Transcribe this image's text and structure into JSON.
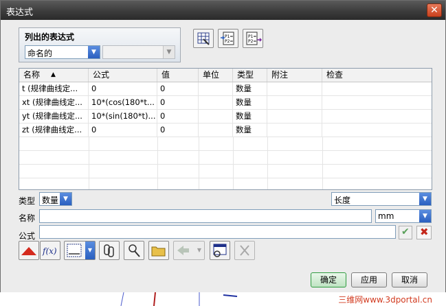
{
  "window": {
    "title": "表达式",
    "close_icon": "close-icon"
  },
  "list_group": {
    "title": "列出的表达式",
    "filter_value": "命名的",
    "secondary_value": ""
  },
  "table": {
    "columns": [
      "名称",
      "公式",
      "值",
      "单位",
      "类型",
      "附注",
      "检查"
    ],
    "rows": [
      {
        "name": "t (规律曲线定...",
        "formula": "0",
        "value": "0",
        "unit": "",
        "type": "数量",
        "note": "",
        "check": ""
      },
      {
        "name": "xt (规律曲线定...",
        "formula": "10*(cos(180*t...",
        "value": "0",
        "unit": "",
        "type": "数量",
        "note": "",
        "check": ""
      },
      {
        "name": "yt (规律曲线定...",
        "formula": "10*(sin(180*t)...",
        "value": "0",
        "unit": "",
        "type": "数量",
        "note": "",
        "check": ""
      },
      {
        "name": "zt (规律曲线定...",
        "formula": "0",
        "value": "0",
        "unit": "",
        "type": "数量",
        "note": "",
        "check": ""
      }
    ]
  },
  "form": {
    "type_label": "类型",
    "type_value": "数量",
    "dimension_value": "长度",
    "name_label": "名称",
    "name_value": "",
    "unit_value": "mm",
    "formula_label": "公式",
    "formula_value": ""
  },
  "footer": {
    "ok_label": "确定",
    "apply_label": "应用",
    "cancel_label": "取消"
  },
  "watermark": "三维网www.3dportal.cn",
  "colors": {
    "title_bar": "#3c3c3c",
    "ok_green": "#2e9a3e",
    "accent_blue": "#2a5fc0",
    "delete_red": "#c4281c"
  }
}
